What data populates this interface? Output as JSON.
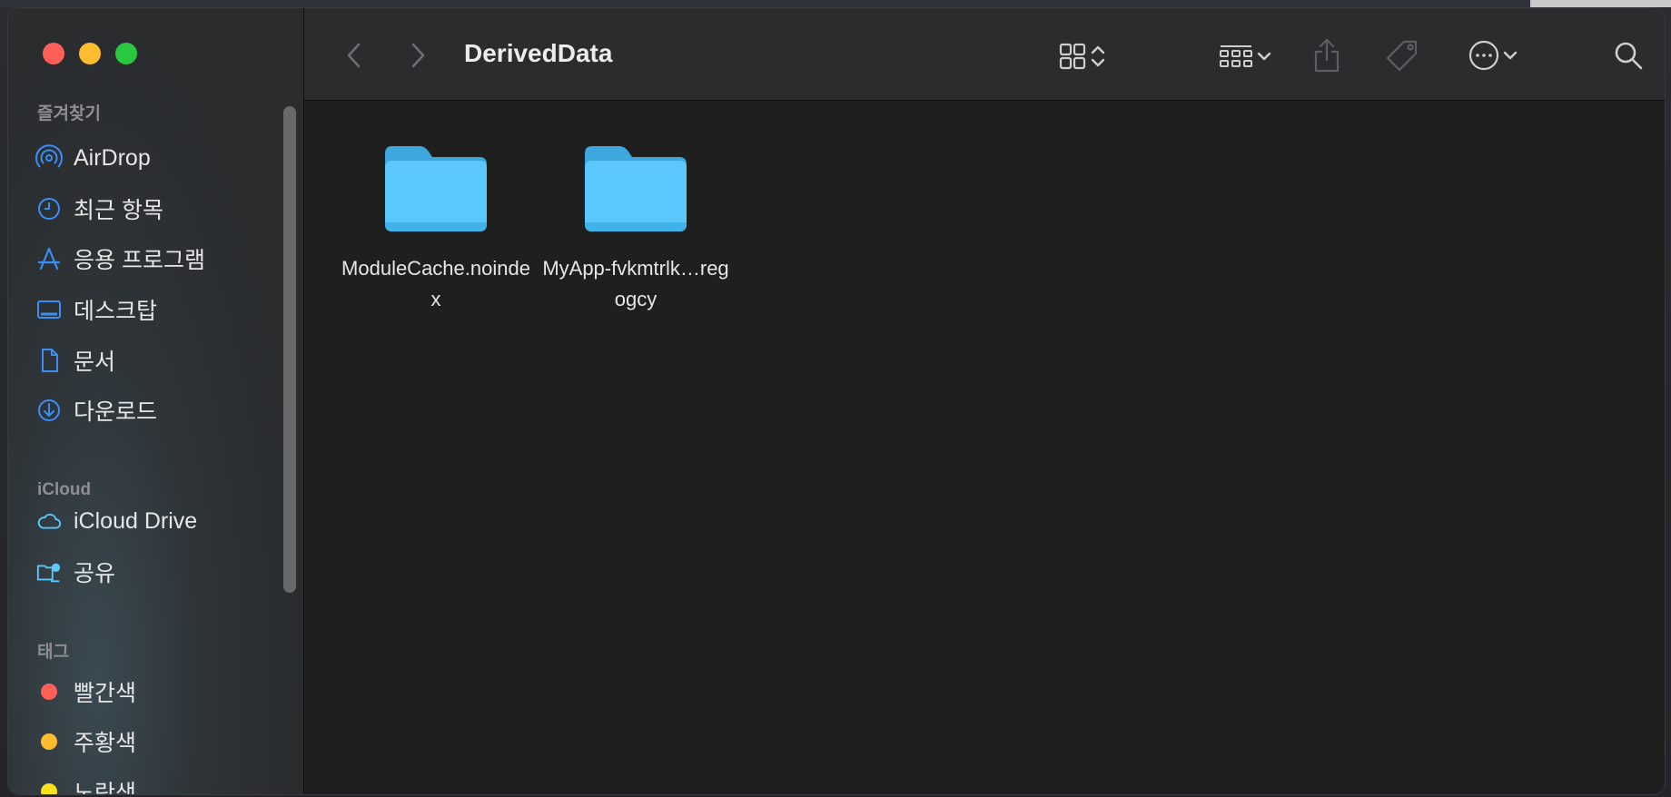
{
  "window": {
    "title": "DerivedData"
  },
  "sidebar": {
    "favorites_label": "즐겨찾기",
    "favorites": [
      {
        "label": "AirDrop",
        "icon": "airdrop-icon"
      },
      {
        "label": "최근 항목",
        "icon": "clock-icon"
      },
      {
        "label": "응용 프로그램",
        "icon": "applications-icon"
      },
      {
        "label": "데스크탑",
        "icon": "desktop-icon"
      },
      {
        "label": "문서",
        "icon": "document-icon"
      },
      {
        "label": "다운로드",
        "icon": "download-icon"
      }
    ],
    "icloud_label": "iCloud",
    "icloud": [
      {
        "label": "iCloud Drive",
        "icon": "cloud-icon"
      },
      {
        "label": "공유",
        "icon": "shared-folder-icon"
      }
    ],
    "tags_label": "태그",
    "tags": [
      {
        "label": "빨간색",
        "color": "#fe5f57"
      },
      {
        "label": "주황색",
        "color": "#febc2e"
      },
      {
        "label": "노란색",
        "color": "#f7e21c"
      }
    ]
  },
  "content": {
    "items": [
      {
        "name": "ModuleCache.noindex",
        "icon": "folder-icon"
      },
      {
        "name": "MyApp-fvkmtrlk…regogcy",
        "icon": "folder-icon"
      }
    ]
  },
  "colors": {
    "accent": "#3a8ef6",
    "folder": "#5ac8fa"
  }
}
